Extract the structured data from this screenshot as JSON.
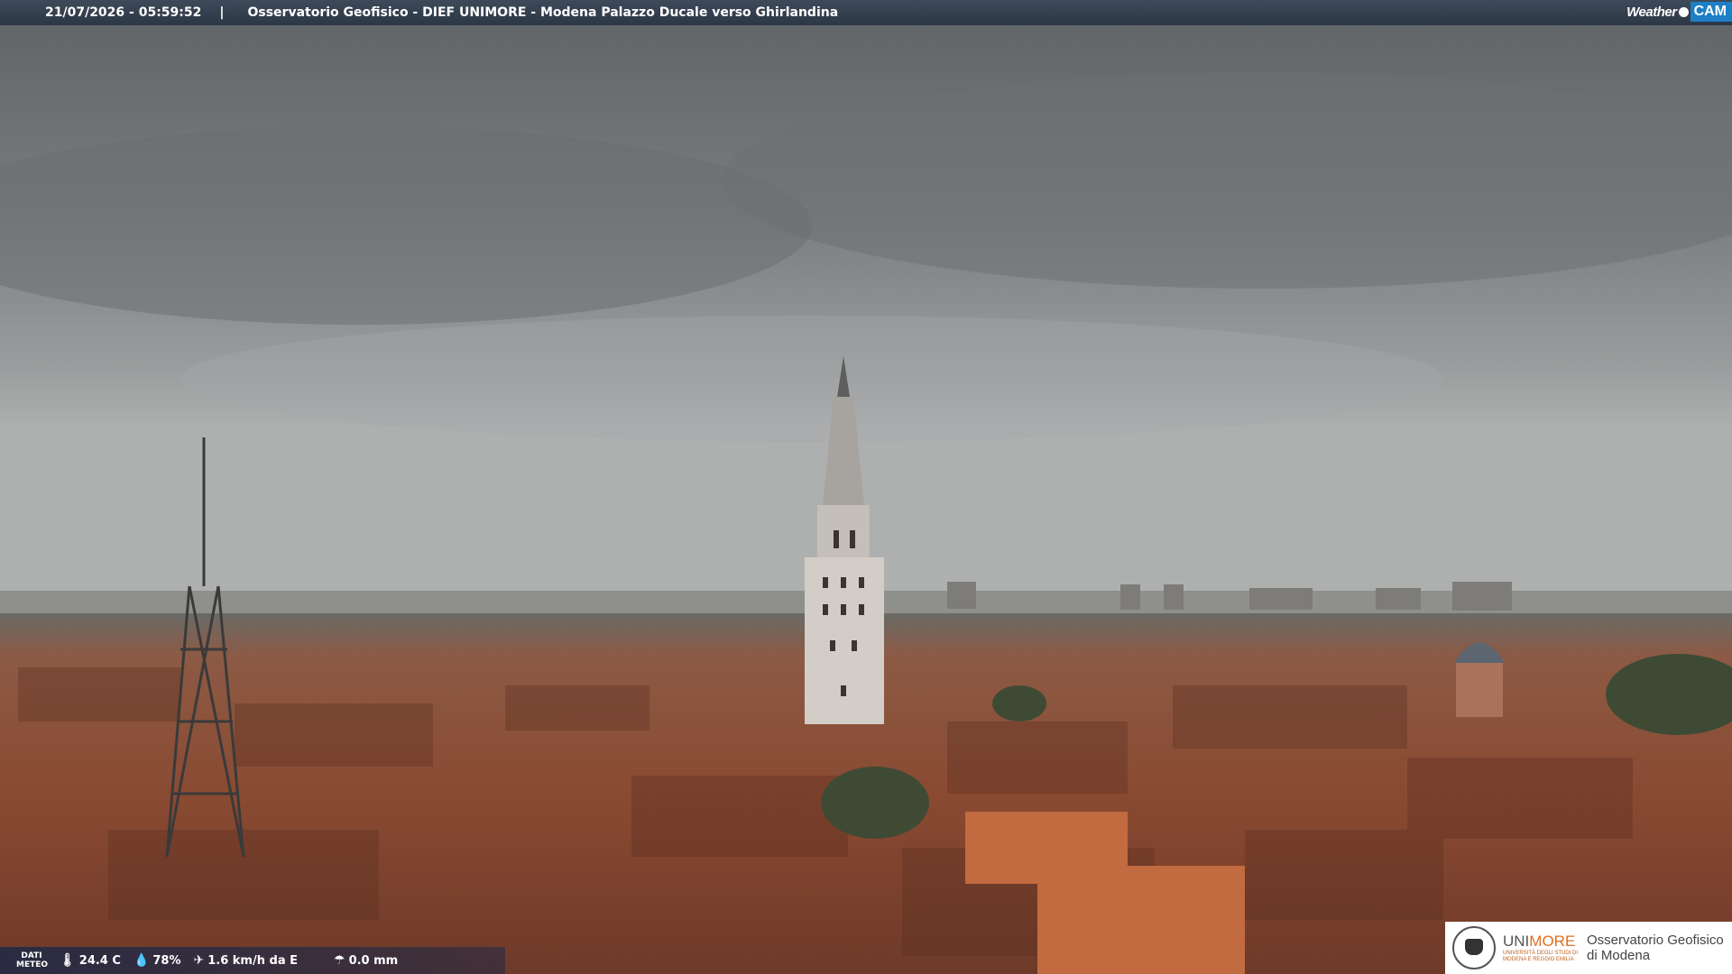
{
  "header": {
    "timestamp": "21/07/2026 - 05:59:52",
    "separator": "|",
    "location": "Osservatorio Geofisico - DIEF UNIMORE - Modena Palazzo Ducale verso Ghirlandina"
  },
  "brand": {
    "weather": "Weather",
    "cam": "CAM"
  },
  "meteo": {
    "label_line1": "DATI",
    "label_line2": "METEO",
    "temperature": "24.4 C",
    "humidity": "78%",
    "wind": "1.6 km/h da E",
    "rain": "0.0 mm",
    "icons": [
      "thermometer-icon",
      "humidity-drop-icon",
      "wind-icon",
      "rain-gauge-icon"
    ]
  },
  "logo": {
    "uni_part1": "UNI",
    "uni_part2": "MORE",
    "uni_sub1": "UNIVERSITÀ DEGLI STUDI DI",
    "uni_sub2": "MODENA E REGGIO EMILIA",
    "obs_line1": "Osservatorio Geofisico",
    "obs_line2": "di Modena"
  },
  "colors": {
    "sky": "#7f8284",
    "roofs": "#8a4a32",
    "brand_blue": "#1d7fc6",
    "brand_orange": "#e07020"
  }
}
